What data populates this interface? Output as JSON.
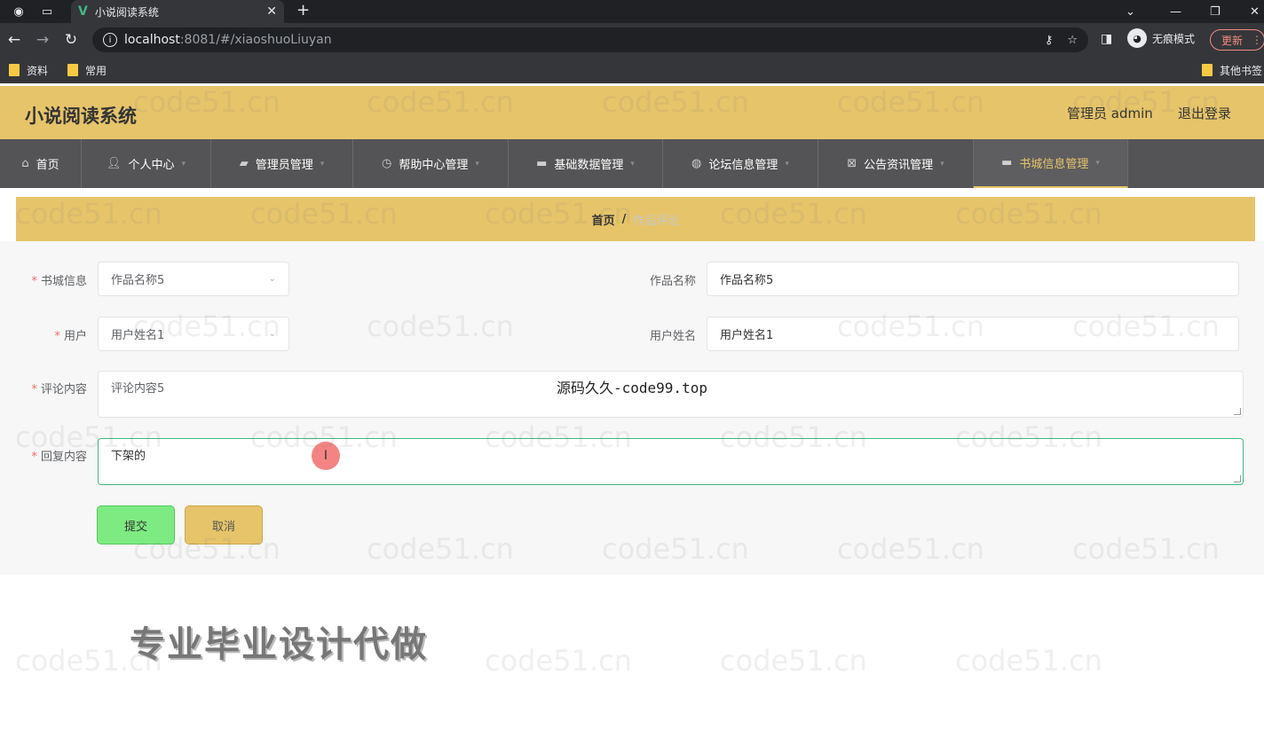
{
  "browser": {
    "tab_title": "小说阅读系统",
    "url_host": "localhost",
    "url_rest": ":8081/#/xiaoshuoLiuyan",
    "incognito_label": "无痕模式",
    "update_label": "更新",
    "bookmarks": [
      "资料",
      "常用"
    ],
    "other_bookmarks": "其他书签"
  },
  "app": {
    "title": "小说阅读系统",
    "admin_label": "管理员 admin",
    "logout_label": "退出登录"
  },
  "menu": {
    "items": [
      {
        "label": "首页",
        "icon": "home-icon"
      },
      {
        "label": "个人中心",
        "icon": "user-icon"
      },
      {
        "label": "管理员管理",
        "icon": "admin-icon"
      },
      {
        "label": "帮助中心管理",
        "icon": "clock-icon"
      },
      {
        "label": "基础数据管理",
        "icon": "monitor-icon"
      },
      {
        "label": "论坛信息管理",
        "icon": "globe-icon"
      },
      {
        "label": "公告资讯管理",
        "icon": "close-square-icon"
      },
      {
        "label": "书城信息管理",
        "icon": "monitor-icon"
      }
    ],
    "active_index": 7
  },
  "breadcrumb": {
    "home": "首页",
    "separator": "/",
    "current": "作品评论"
  },
  "form": {
    "book_label": "书城信息",
    "book_value": "作品名称5",
    "work_name_label": "作品名称",
    "work_name_value": "作品名称5",
    "user_label": "用户",
    "user_value": "用户姓名1",
    "user_name_label": "用户姓名",
    "user_name_value": "用户姓名1",
    "comment_label": "评论内容",
    "comment_value": "评论内容5",
    "reply_label": "回复内容",
    "reply_value": "下架的",
    "submit_label": "提交",
    "cancel_label": "取消"
  },
  "overlay": {
    "source_text": "源码久久-code99.top",
    "promo_text": "专业毕业设计代做",
    "watermark": "code51.cn"
  },
  "colors": {
    "header": "#e6c46a",
    "menubar": "#545456",
    "submit": "#7deb82",
    "focus_border": "#3fb984"
  }
}
